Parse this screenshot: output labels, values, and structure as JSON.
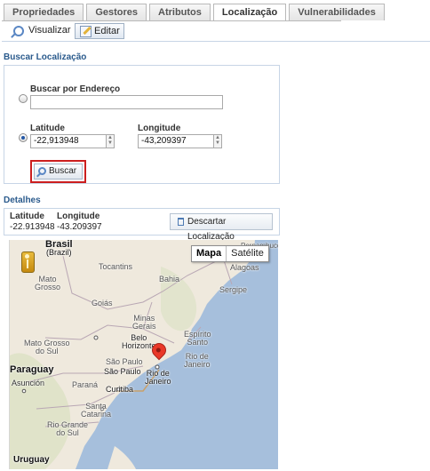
{
  "tabs": [
    {
      "label": "Propriedades",
      "active": false
    },
    {
      "label": "Gestores",
      "active": false
    },
    {
      "label": "Atributos",
      "active": false
    },
    {
      "label": "Localização",
      "active": true
    },
    {
      "label": "Vulnerabilidades",
      "active": false
    }
  ],
  "toolbar": {
    "visualizar_label": "Visualizar",
    "editar_label": "Editar"
  },
  "buscar": {
    "section_title": "Buscar Localização",
    "endereco_label": "Buscar por Endereço",
    "endereco_value": "",
    "latitude_label": "Latitude",
    "latitude_value": "-22,913948",
    "longitude_label": "Longitude",
    "longitude_value": "-43,209397",
    "mode": "coordinates",
    "button_label": "Buscar"
  },
  "detalhes": {
    "section_title": "Detalhes",
    "latitude_label": "Latitude",
    "latitude_value": "-22.913948",
    "longitude_label": "Longitude",
    "longitude_value": "-43.209397",
    "descartar_label": "Descartar Localização"
  },
  "map": {
    "type_selected": "Mapa",
    "type_other": "Satélite",
    "labels": {
      "brasil": "Brasil",
      "brazil": "(Brazil)",
      "pernambuco": "Pernambuco",
      "tocantins": "Tocantins",
      "alagoas": "Alagoas",
      "bahia": "Bahia",
      "mato_grosso": "Mato",
      "mato_grosso_2": "Grosso",
      "sergipe": "Sergipe",
      "goias": "Goiás",
      "minas_gerais": "Minas",
      "minas_gerais_2": "Gerais",
      "belo_horizonte": "Belo",
      "belo_horizonte_2": "Horizonte",
      "espirito_santo": "Espírito",
      "espirito_santo_2": "Santo",
      "mato_grosso_sul": "Mato Grosso",
      "mato_grosso_sul_2": "do Sul",
      "rio_de_janeiro_state": "Rio de",
      "rio_de_janeiro_state_2": "Janeiro",
      "sao_paulo_state": "São Paulo",
      "sao_paulo_city": "São Paulo",
      "paraguay": "Paraguay",
      "rio_de_janeiro_city": "Rio de",
      "rio_de_janeiro_city_2": "Janeiro",
      "asuncion": "Asunción",
      "parana": "Paraná",
      "curitiba": "Curitiba",
      "santa_catarina": "Santa",
      "santa_catarina_2": "Catarina",
      "rio_grande_sul": "Rio Grande",
      "rio_grande_sul_2": "do Sul",
      "uruguay": "Uruguay"
    },
    "colors": {
      "land": "#efe9dd",
      "water": "#a6bfdc",
      "green": "#cfdcb1",
      "border": "#b9a7b4"
    }
  }
}
